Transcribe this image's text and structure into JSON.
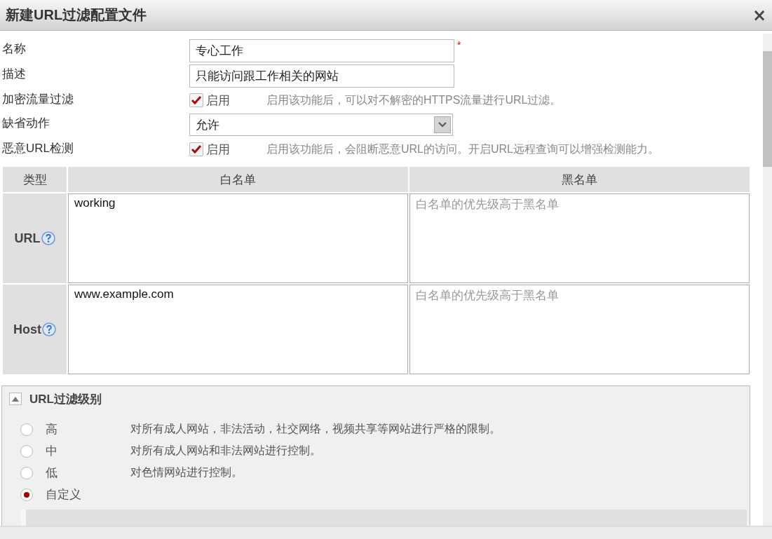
{
  "dialog": {
    "title": "新建URL过滤配置文件",
    "close": "×"
  },
  "fields": [
    {
      "kind": "text",
      "label": "名称",
      "value": "专心工作",
      "required_mark": "*"
    },
    {
      "kind": "text",
      "label": "描述",
      "value": "只能访问跟工作相关的网站"
    },
    {
      "kind": "checkbox",
      "label": "加密流量过滤",
      "option": "启用",
      "checked": true,
      "hint": "启用该功能后，可以对不解密的HTTPS流量进行URL过滤。"
    },
    {
      "kind": "select",
      "label": "缺省动作",
      "value": "允许"
    },
    {
      "kind": "checkbox",
      "label": "恶意URL检测",
      "option": "启用",
      "checked": true,
      "hint": "启用该功能后，会阻断恶意URL的访问。开启URL远程查询可以增强检测能力。"
    }
  ],
  "list_table": {
    "columns": [
      "类型",
      "白名单",
      "黑名单"
    ],
    "rows": [
      {
        "type": "URL",
        "whitelist": {
          "value": "working"
        },
        "blacklist": {
          "placeholder": "白名单的优先级高于黑名单"
        }
      },
      {
        "type": "Host",
        "whitelist": {
          "value": "www.example.com"
        },
        "blacklist": {
          "placeholder": "白名单的优先级高于黑名单"
        }
      }
    ]
  },
  "filter_level": {
    "title": "URL过滤级别",
    "expanded": true,
    "options": [
      {
        "label": "高",
        "description": "对所有成人网站，非法活动，社交网络，视频共享等网站进行严格的限制。",
        "selected": false
      },
      {
        "label": "中",
        "description": "对所有成人网站和非法网站进行控制。",
        "selected": false
      },
      {
        "label": "低",
        "description": "对色情网站进行控制。",
        "selected": false
      },
      {
        "label": "自定义",
        "selected": true
      }
    ]
  }
}
